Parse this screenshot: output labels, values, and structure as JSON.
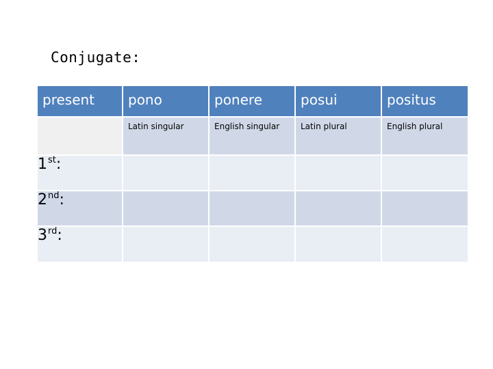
{
  "title": "Conjugate:",
  "table": {
    "header": [
      "present",
      "pono",
      "ponere",
      "posui",
      "positus"
    ],
    "subheader": [
      "",
      "Latin singular",
      "English singular",
      "Latin plural",
      "English plural"
    ],
    "rows": [
      {
        "num": "1",
        "suffix": "st",
        "colon": ":",
        "cells": [
          "",
          "",
          "",
          ""
        ]
      },
      {
        "num": "2",
        "suffix": "nd",
        "colon": ":",
        "cells": [
          "",
          "",
          "",
          ""
        ]
      },
      {
        "num": "3",
        "suffix": "rd",
        "colon": ":",
        "cells": [
          "",
          "",
          "",
          ""
        ]
      }
    ]
  },
  "colors": {
    "header_bg": "#4f81bd",
    "band_dark": "#d0d8e8",
    "band_light": "#e9edf4"
  }
}
